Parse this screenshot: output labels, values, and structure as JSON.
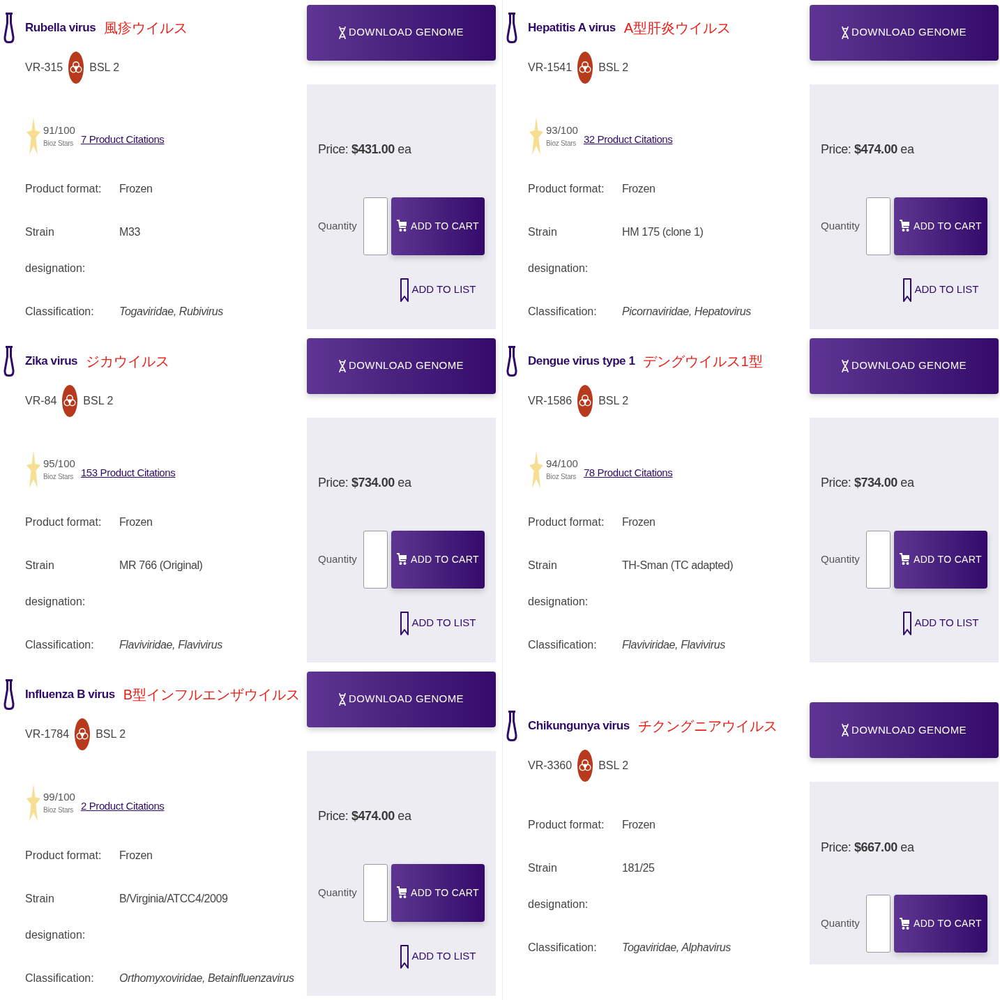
{
  "products": [
    {
      "name": "Rubella virus",
      "name_ja": "風疹ウイルス",
      "catalog_number": "VR-315",
      "biosafety_level": "BSL 2",
      "bioz": {
        "score": "91/100",
        "label": "Bioz Stars",
        "citations": "7 Product Citations"
      },
      "details": [
        {
          "kind": "plain",
          "label": "Product format:",
          "value": "Frozen"
        },
        {
          "kind": "plain",
          "label": "Strain designation:",
          "value": "M33"
        },
        {
          "kind": "taxonomy",
          "label": "Classification:",
          "value": "Togaviridae, Rubivirus"
        }
      ],
      "download_button": "DOWNLOAD GENOME",
      "price": "Price: **$431.00** ea",
      "quantity_label": "Quantity",
      "add_to_cart": "ADD TO CART",
      "add_to_list": "ADD TO LIST"
    },
    {
      "name": "Hepatitis A virus",
      "name_ja": "A型肝炎ウイルス",
      "catalog_number": "VR-1541",
      "biosafety_level": "BSL 2",
      "bioz": {
        "score": "93/100",
        "label": "Bioz Stars",
        "citations": "32 Product Citations"
      },
      "details": [
        {
          "kind": "plain",
          "label": "Product format:",
          "value": "Frozen"
        },
        {
          "kind": "plain",
          "label": "Strain designation:",
          "value": "HM 175 (clone 1)"
        },
        {
          "kind": "taxonomy",
          "label": "Classification:",
          "value": "Picornaviridae, Hepatovirus"
        }
      ],
      "download_button": "DOWNLOAD GENOME",
      "price": "Price: **$474.00** ea",
      "quantity_label": "Quantity",
      "add_to_cart": "ADD TO CART",
      "add_to_list": "ADD TO LIST"
    },
    {
      "name": "Zika virus",
      "name_ja": "ジカウイルス",
      "catalog_number": "VR-84",
      "biosafety_level": "BSL 2",
      "bioz": {
        "score": "95/100",
        "label": "Bioz Stars",
        "citations": "153 Product Citations"
      },
      "details": [
        {
          "kind": "plain",
          "label": "Product format:",
          "value": "Frozen"
        },
        {
          "kind": "plain",
          "label": "Strain designation:",
          "value": "MR 766 (Original)"
        },
        {
          "kind": "taxonomy",
          "label": "Classification:",
          "value": "Flaviviridae, Flavivirus"
        }
      ],
      "download_button": "DOWNLOAD GENOME",
      "price": "Price: **$734.00** ea",
      "quantity_label": "Quantity",
      "add_to_cart": "ADD TO CART",
      "add_to_list": "ADD TO LIST"
    },
    {
      "name": "Dengue virus type 1",
      "name_ja": "デングウイルス1型",
      "catalog_number": "VR-1586",
      "biosafety_level": "BSL 2",
      "bioz": {
        "score": "94/100",
        "label": "Bioz Stars",
        "citations": "78 Product Citations"
      },
      "details": [
        {
          "kind": "plain",
          "label": "Product format:",
          "value": "Frozen"
        },
        {
          "kind": "plain",
          "label": "Strain designation:",
          "value": "TH-Sman (TC adapted)"
        },
        {
          "kind": "taxonomy",
          "label": "Classification:",
          "value": "Flaviviridae, Flavivirus"
        }
      ],
      "download_button": "DOWNLOAD GENOME",
      "price": "Price: **$734.00** ea",
      "quantity_label": "Quantity",
      "add_to_cart": "ADD TO CART",
      "add_to_list": "ADD TO LIST"
    },
    {
      "name": "Influenza B virus",
      "name_ja": "B型インフルエンザウイルス",
      "catalog_number": "VR-1784",
      "biosafety_level": "BSL 2",
      "bioz": {
        "score": "99/100",
        "label": "Bioz Stars",
        "citations": "2 Product Citations"
      },
      "details": [
        {
          "kind": "plain",
          "label": "Product format:",
          "value": "Frozen"
        },
        {
          "kind": "plain",
          "label": "Strain designation:",
          "value": "B/Virginia/ATCC4/2009"
        },
        {
          "kind": "taxonomy",
          "label": "Classification:",
          "value": "Orthomyxoviridae, Betainfluenzavirus"
        }
      ],
      "download_button": "DOWNLOAD GENOME",
      "price": "Price: **$474.00** ea",
      "quantity_label": "Quantity",
      "add_to_cart": "ADD TO CART",
      "add_to_list": "ADD TO LIST"
    },
    {
      "name": "Chikungunya virus",
      "name_ja": "チクングニアウイルス",
      "catalog_number": "VR-3360",
      "biosafety_level": "BSL 2",
      "details": [
        {
          "kind": "plain",
          "label": "Product format:",
          "value": "Frozen"
        },
        {
          "kind": "plain",
          "label": "Strain designation:",
          "value": "181/25"
        },
        {
          "kind": "taxonomy",
          "label": "Classification:",
          "value": "Togaviridae, Alphavirus"
        }
      ],
      "download_button": "DOWNLOAD GENOME",
      "price": "Price: **$667.00** ea",
      "quantity_label": "Quantity",
      "add_to_cart": "ADD TO CART"
    }
  ]
}
